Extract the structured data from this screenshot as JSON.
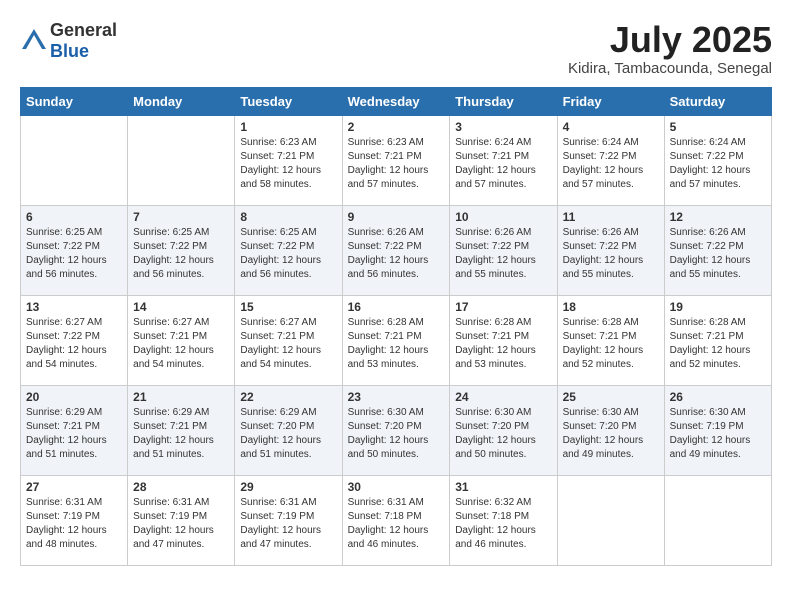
{
  "header": {
    "logo_general": "General",
    "logo_blue": "Blue",
    "month_year": "July 2025",
    "location": "Kidira, Tambacounda, Senegal"
  },
  "weekdays": [
    "Sunday",
    "Monday",
    "Tuesday",
    "Wednesday",
    "Thursday",
    "Friday",
    "Saturday"
  ],
  "weeks": [
    [
      {
        "day": "",
        "sunrise": "",
        "sunset": "",
        "daylight": ""
      },
      {
        "day": "",
        "sunrise": "",
        "sunset": "",
        "daylight": ""
      },
      {
        "day": "1",
        "sunrise": "Sunrise: 6:23 AM",
        "sunset": "Sunset: 7:21 PM",
        "daylight": "Daylight: 12 hours and 58 minutes."
      },
      {
        "day": "2",
        "sunrise": "Sunrise: 6:23 AM",
        "sunset": "Sunset: 7:21 PM",
        "daylight": "Daylight: 12 hours and 57 minutes."
      },
      {
        "day": "3",
        "sunrise": "Sunrise: 6:24 AM",
        "sunset": "Sunset: 7:21 PM",
        "daylight": "Daylight: 12 hours and 57 minutes."
      },
      {
        "day": "4",
        "sunrise": "Sunrise: 6:24 AM",
        "sunset": "Sunset: 7:22 PM",
        "daylight": "Daylight: 12 hours and 57 minutes."
      },
      {
        "day": "5",
        "sunrise": "Sunrise: 6:24 AM",
        "sunset": "Sunset: 7:22 PM",
        "daylight": "Daylight: 12 hours and 57 minutes."
      }
    ],
    [
      {
        "day": "6",
        "sunrise": "Sunrise: 6:25 AM",
        "sunset": "Sunset: 7:22 PM",
        "daylight": "Daylight: 12 hours and 56 minutes."
      },
      {
        "day": "7",
        "sunrise": "Sunrise: 6:25 AM",
        "sunset": "Sunset: 7:22 PM",
        "daylight": "Daylight: 12 hours and 56 minutes."
      },
      {
        "day": "8",
        "sunrise": "Sunrise: 6:25 AM",
        "sunset": "Sunset: 7:22 PM",
        "daylight": "Daylight: 12 hours and 56 minutes."
      },
      {
        "day": "9",
        "sunrise": "Sunrise: 6:26 AM",
        "sunset": "Sunset: 7:22 PM",
        "daylight": "Daylight: 12 hours and 56 minutes."
      },
      {
        "day": "10",
        "sunrise": "Sunrise: 6:26 AM",
        "sunset": "Sunset: 7:22 PM",
        "daylight": "Daylight: 12 hours and 55 minutes."
      },
      {
        "day": "11",
        "sunrise": "Sunrise: 6:26 AM",
        "sunset": "Sunset: 7:22 PM",
        "daylight": "Daylight: 12 hours and 55 minutes."
      },
      {
        "day": "12",
        "sunrise": "Sunrise: 6:26 AM",
        "sunset": "Sunset: 7:22 PM",
        "daylight": "Daylight: 12 hours and 55 minutes."
      }
    ],
    [
      {
        "day": "13",
        "sunrise": "Sunrise: 6:27 AM",
        "sunset": "Sunset: 7:22 PM",
        "daylight": "Daylight: 12 hours and 54 minutes."
      },
      {
        "day": "14",
        "sunrise": "Sunrise: 6:27 AM",
        "sunset": "Sunset: 7:21 PM",
        "daylight": "Daylight: 12 hours and 54 minutes."
      },
      {
        "day": "15",
        "sunrise": "Sunrise: 6:27 AM",
        "sunset": "Sunset: 7:21 PM",
        "daylight": "Daylight: 12 hours and 54 minutes."
      },
      {
        "day": "16",
        "sunrise": "Sunrise: 6:28 AM",
        "sunset": "Sunset: 7:21 PM",
        "daylight": "Daylight: 12 hours and 53 minutes."
      },
      {
        "day": "17",
        "sunrise": "Sunrise: 6:28 AM",
        "sunset": "Sunset: 7:21 PM",
        "daylight": "Daylight: 12 hours and 53 minutes."
      },
      {
        "day": "18",
        "sunrise": "Sunrise: 6:28 AM",
        "sunset": "Sunset: 7:21 PM",
        "daylight": "Daylight: 12 hours and 52 minutes."
      },
      {
        "day": "19",
        "sunrise": "Sunrise: 6:28 AM",
        "sunset": "Sunset: 7:21 PM",
        "daylight": "Daylight: 12 hours and 52 minutes."
      }
    ],
    [
      {
        "day": "20",
        "sunrise": "Sunrise: 6:29 AM",
        "sunset": "Sunset: 7:21 PM",
        "daylight": "Daylight: 12 hours and 51 minutes."
      },
      {
        "day": "21",
        "sunrise": "Sunrise: 6:29 AM",
        "sunset": "Sunset: 7:21 PM",
        "daylight": "Daylight: 12 hours and 51 minutes."
      },
      {
        "day": "22",
        "sunrise": "Sunrise: 6:29 AM",
        "sunset": "Sunset: 7:20 PM",
        "daylight": "Daylight: 12 hours and 51 minutes."
      },
      {
        "day": "23",
        "sunrise": "Sunrise: 6:30 AM",
        "sunset": "Sunset: 7:20 PM",
        "daylight": "Daylight: 12 hours and 50 minutes."
      },
      {
        "day": "24",
        "sunrise": "Sunrise: 6:30 AM",
        "sunset": "Sunset: 7:20 PM",
        "daylight": "Daylight: 12 hours and 50 minutes."
      },
      {
        "day": "25",
        "sunrise": "Sunrise: 6:30 AM",
        "sunset": "Sunset: 7:20 PM",
        "daylight": "Daylight: 12 hours and 49 minutes."
      },
      {
        "day": "26",
        "sunrise": "Sunrise: 6:30 AM",
        "sunset": "Sunset: 7:19 PM",
        "daylight": "Daylight: 12 hours and 49 minutes."
      }
    ],
    [
      {
        "day": "27",
        "sunrise": "Sunrise: 6:31 AM",
        "sunset": "Sunset: 7:19 PM",
        "daylight": "Daylight: 12 hours and 48 minutes."
      },
      {
        "day": "28",
        "sunrise": "Sunrise: 6:31 AM",
        "sunset": "Sunset: 7:19 PM",
        "daylight": "Daylight: 12 hours and 47 minutes."
      },
      {
        "day": "29",
        "sunrise": "Sunrise: 6:31 AM",
        "sunset": "Sunset: 7:19 PM",
        "daylight": "Daylight: 12 hours and 47 minutes."
      },
      {
        "day": "30",
        "sunrise": "Sunrise: 6:31 AM",
        "sunset": "Sunset: 7:18 PM",
        "daylight": "Daylight: 12 hours and 46 minutes."
      },
      {
        "day": "31",
        "sunrise": "Sunrise: 6:32 AM",
        "sunset": "Sunset: 7:18 PM",
        "daylight": "Daylight: 12 hours and 46 minutes."
      },
      {
        "day": "",
        "sunrise": "",
        "sunset": "",
        "daylight": ""
      },
      {
        "day": "",
        "sunrise": "",
        "sunset": "",
        "daylight": ""
      }
    ]
  ]
}
